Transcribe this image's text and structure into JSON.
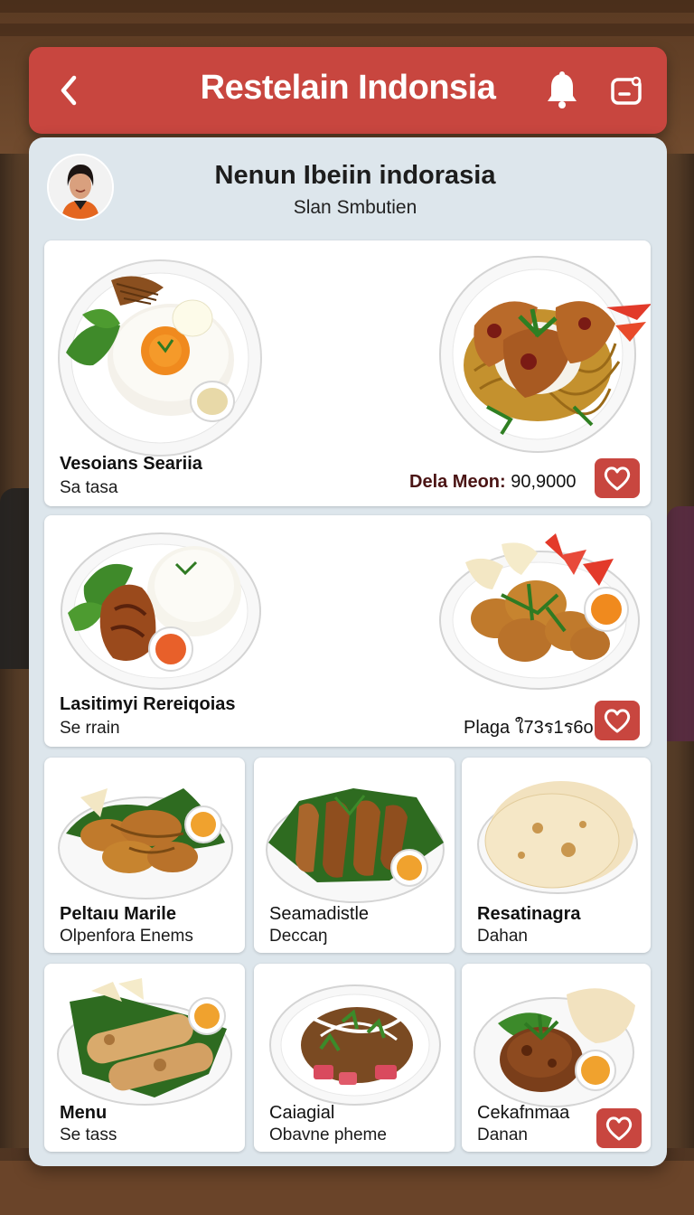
{
  "header": {
    "title": "Restelain Indonsia",
    "back_icon": "chevron-left-icon",
    "bell_icon": "bell-icon",
    "cart_icon": "cart-icon",
    "accent_color": "#c8463f"
  },
  "panel": {
    "title": "Nenun Ibeiin indorasia",
    "subtitle": "Slan Smbutien"
  },
  "menu": {
    "featured": [
      {
        "name": "Vesoians Seariia",
        "sub": "Sa tasa",
        "price_label": "Dela Meon:",
        "price": "90,9000"
      },
      {
        "name": "Lasitimyi Rereiqoias",
        "sub": "Se rrain",
        "price": "Plaga ใ73ร1ร6o"
      }
    ],
    "grid": [
      {
        "name": "Peltaıu Marile",
        "sub": "Olpenfora Enems"
      },
      {
        "name": "Seamadistle",
        "sub": "Deccaŋ"
      },
      {
        "name": "Resatinagra",
        "sub": "Dahan"
      },
      {
        "name": "Menu",
        "sub": "Se tass"
      },
      {
        "name": "Caiagial",
        "sub": "Obavne pheme"
      },
      {
        "name": "Cekafnmaa",
        "sub": "Danan"
      }
    ]
  }
}
